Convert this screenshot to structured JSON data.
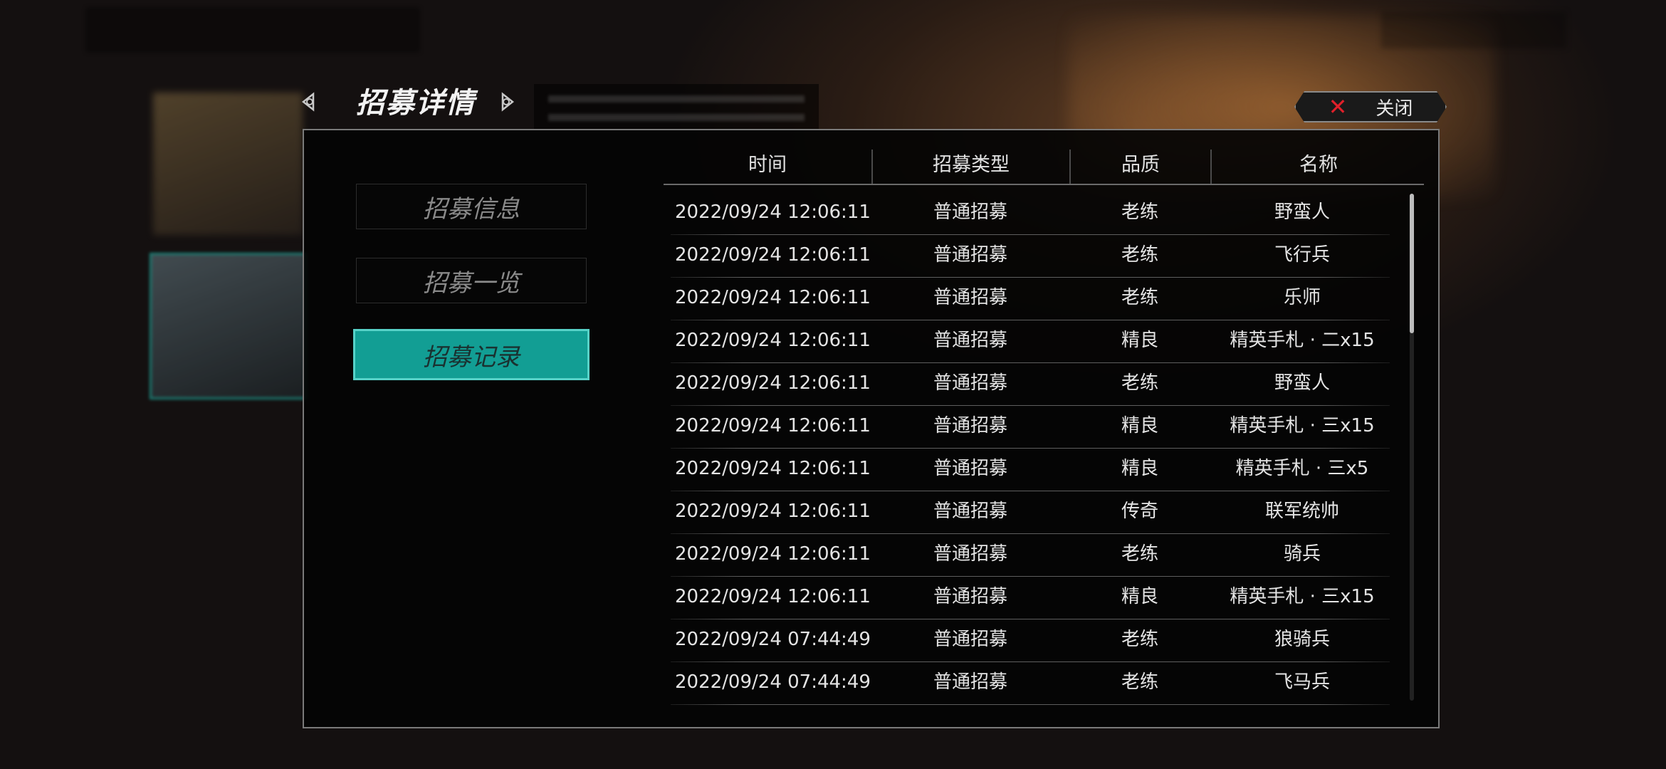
{
  "header": {
    "title": "招募详情",
    "prev_icon": "triquetra-left-icon",
    "next_icon": "triquetra-right-icon",
    "close_label": "关闭",
    "close_icon": "close-x-icon"
  },
  "sidebar": {
    "items": [
      {
        "label": "招募信息",
        "active": false
      },
      {
        "label": "招募一览",
        "active": false
      },
      {
        "label": "招募记录",
        "active": true
      }
    ]
  },
  "table": {
    "columns": [
      "时间",
      "招募类型",
      "品质",
      "名称"
    ],
    "rows": [
      {
        "time": "2022/09/24  12:06:11",
        "type": "普通招募",
        "quality": "老练",
        "name": "野蛮人"
      },
      {
        "time": "2022/09/24  12:06:11",
        "type": "普通招募",
        "quality": "老练",
        "name": "飞行兵"
      },
      {
        "time": "2022/09/24  12:06:11",
        "type": "普通招募",
        "quality": "老练",
        "name": "乐师"
      },
      {
        "time": "2022/09/24  12:06:11",
        "type": "普通招募",
        "quality": "精良",
        "name": "精英手札 · 二x15"
      },
      {
        "time": "2022/09/24  12:06:11",
        "type": "普通招募",
        "quality": "老练",
        "name": "野蛮人"
      },
      {
        "time": "2022/09/24  12:06:11",
        "type": "普通招募",
        "quality": "精良",
        "name": "精英手札 · 三x15"
      },
      {
        "time": "2022/09/24  12:06:11",
        "type": "普通招募",
        "quality": "精良",
        "name": "精英手札 · 三x5"
      },
      {
        "time": "2022/09/24  12:06:11",
        "type": "普通招募",
        "quality": "传奇",
        "name": "联军统帅"
      },
      {
        "time": "2022/09/24  12:06:11",
        "type": "普通招募",
        "quality": "老练",
        "name": "骑兵"
      },
      {
        "time": "2022/09/24  12:06:11",
        "type": "普通招募",
        "quality": "精良",
        "name": "精英手札 · 三x15"
      },
      {
        "time": "2022/09/24  07:44:49",
        "type": "普通招募",
        "quality": "老练",
        "name": "狼骑兵"
      },
      {
        "time": "2022/09/24  07:44:49",
        "type": "普通招募",
        "quality": "老练",
        "name": "飞马兵"
      }
    ]
  },
  "colors": {
    "accent": "#129e94",
    "close_x": "#e0202a",
    "panel_bg": "#060606"
  }
}
